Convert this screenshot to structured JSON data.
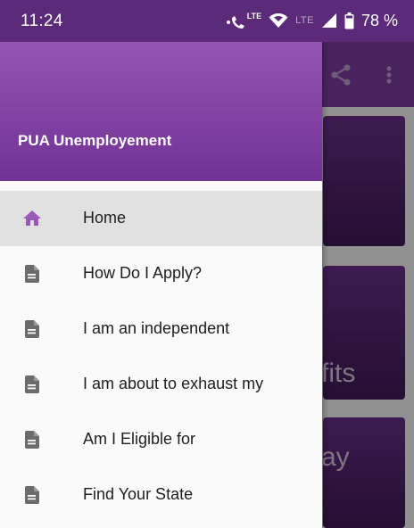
{
  "status_bar": {
    "time": "11:24",
    "volte_label": "LTE",
    "network_label": "LTE",
    "battery": "78 %"
  },
  "drawer": {
    "title": "PUA Unemployement",
    "accent_color": "#9b59b6",
    "items": [
      {
        "label": "Home",
        "icon": "home-icon",
        "selected": true
      },
      {
        "label": "How Do I Apply?",
        "icon": "document-icon"
      },
      {
        "label": "I am an independent",
        "icon": "document-icon"
      },
      {
        "label": "I am about to exhaust my",
        "icon": "document-icon"
      },
      {
        "label": "Am I Eligible for",
        "icon": "document-icon"
      },
      {
        "label": "Find Your State",
        "icon": "document-icon"
      }
    ]
  },
  "background": {
    "partial_text_1": "fits",
    "partial_text_2": "ay"
  }
}
